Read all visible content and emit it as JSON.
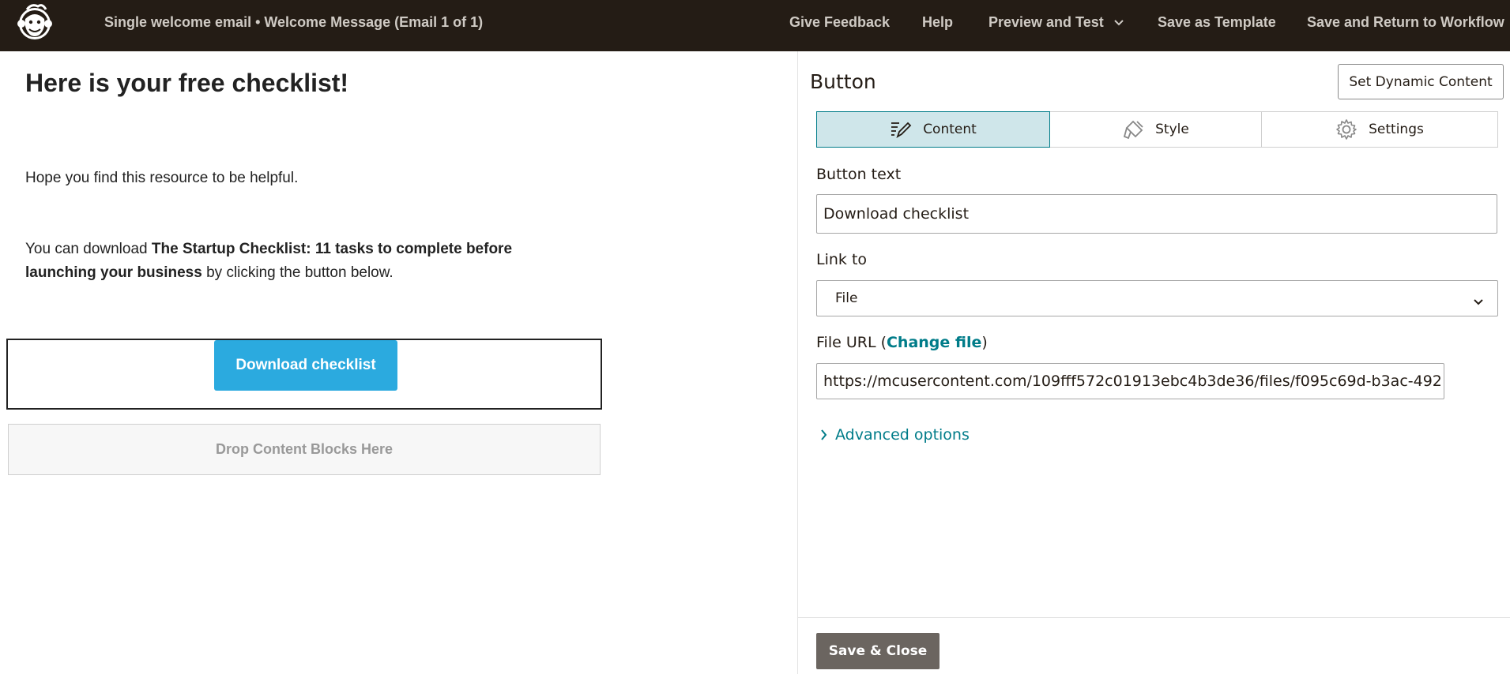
{
  "header": {
    "title": "Single welcome email • Welcome Message (Email 1 of 1)",
    "nav": {
      "feedback": "Give Feedback",
      "help": "Help",
      "preview": "Preview and Test",
      "save_template": "Save as Template",
      "save_return": "Save and Return to Workflow"
    },
    "logo_icon": "freddie-monkey-logo"
  },
  "canvas": {
    "heading": "Here is your free checklist!",
    "paragraph1": "Hope you find this resource to be helpful.",
    "paragraph2_prefix": "You can download ",
    "paragraph2_bold": "The Startup Checklist: 11 tasks to complete before launching your business",
    "paragraph2_suffix": " by clicking the button below.",
    "button_label": "Download checklist",
    "drop_zone": "Drop Content Blocks Here",
    "button_color": "#2baadf"
  },
  "panel": {
    "title": "Button",
    "dynamic_content": "Set Dynamic Content",
    "tabs": [
      {
        "label": "Content",
        "icon": "edit-pen-icon",
        "active": true
      },
      {
        "label": "Style",
        "icon": "paint-brush-icon",
        "active": false
      },
      {
        "label": "Settings",
        "icon": "gear-icon",
        "active": false
      }
    ],
    "button_text_label": "Button text",
    "button_text_value": "Download checklist",
    "link_to_label": "Link to",
    "link_to_value": "File",
    "file_url_label_prefix": "File URL (",
    "file_url_link": "Change file",
    "file_url_label_suffix": ")",
    "file_url_value": "https://mcusercontent.com/109fff572c01913ebc4b3de36/files/f095c69d-b3ac-492",
    "advanced_options": "Advanced options",
    "save_close": "Save & Close",
    "accent_color": "#007c89"
  }
}
